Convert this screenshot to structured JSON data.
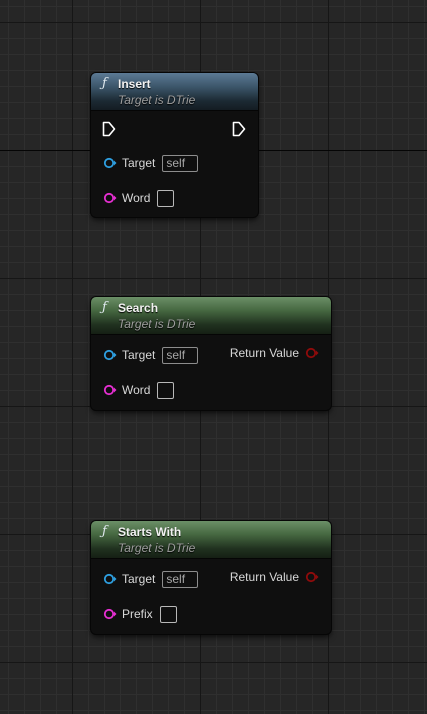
{
  "nodes": [
    {
      "title": "Insert",
      "subtitle": "Target is DTrie",
      "style": "impure",
      "inputs": [
        {
          "label": "Target",
          "value": "self",
          "type": "object"
        },
        {
          "label": "Word",
          "value": "",
          "type": "string"
        }
      ],
      "has_exec": true
    },
    {
      "title": "Search",
      "subtitle": "Target is DTrie",
      "style": "pure",
      "inputs": [
        {
          "label": "Target",
          "value": "self",
          "type": "object"
        },
        {
          "label": "Word",
          "value": "",
          "type": "string"
        }
      ],
      "output": {
        "label": "Return Value",
        "type": "bool"
      }
    },
    {
      "title": "Starts With",
      "subtitle": "Target is DTrie",
      "style": "pure",
      "inputs": [
        {
          "label": "Target",
          "value": "self",
          "type": "object"
        },
        {
          "label": "Prefix",
          "value": "",
          "type": "string"
        }
      ],
      "output": {
        "label": "Return Value",
        "type": "bool"
      }
    }
  ],
  "icons": {
    "function": "function-icon",
    "exec": "exec-pin-icon",
    "object_pin": "object-pin-icon",
    "string_pin": "string-pin-icon",
    "bool_pin": "bool-pin-icon"
  },
  "colors": {
    "object_pin": "#2e9fe0",
    "string_pin": "#e62fd2",
    "bool_pin": "#8f0b0b",
    "exec_pin": "#ffffff",
    "impure_header": "#4c6a84",
    "pure_header": "#5b7f57",
    "graph_background": "#262626"
  },
  "glyphs": {
    "function": "ƒ"
  }
}
